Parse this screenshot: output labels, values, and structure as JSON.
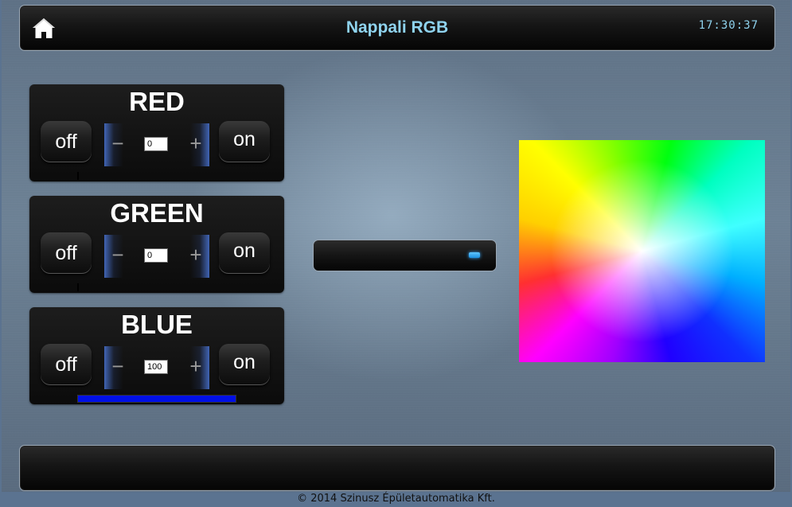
{
  "header": {
    "title": "Nappali RGB",
    "time": "17:30:37",
    "home_icon": "home-icon"
  },
  "channels": [
    {
      "title": "RED",
      "off_label": "off",
      "on_label": "on",
      "minus_label": "−",
      "plus_label": "+",
      "value": "0",
      "level_percent": 0,
      "level_color": "#0010e6"
    },
    {
      "title": "GREEN",
      "off_label": "off",
      "on_label": "on",
      "minus_label": "−",
      "plus_label": "+",
      "value": "0",
      "level_percent": 0,
      "level_color": "#0010e6"
    },
    {
      "title": "BLUE",
      "off_label": "off",
      "on_label": "on",
      "minus_label": "−",
      "plus_label": "+",
      "value": "100",
      "level_percent": 100,
      "level_color": "#0010e6"
    }
  ],
  "master_slider": {
    "indicator_color": "#3aaaff"
  },
  "color_picker": {
    "icon": "color-palette"
  },
  "footer": {
    "copyright": "© 2014 Szinusz Épületautomatika Kft."
  },
  "colors": {
    "accent": "#8fd3ee",
    "panel": "#121212"
  }
}
